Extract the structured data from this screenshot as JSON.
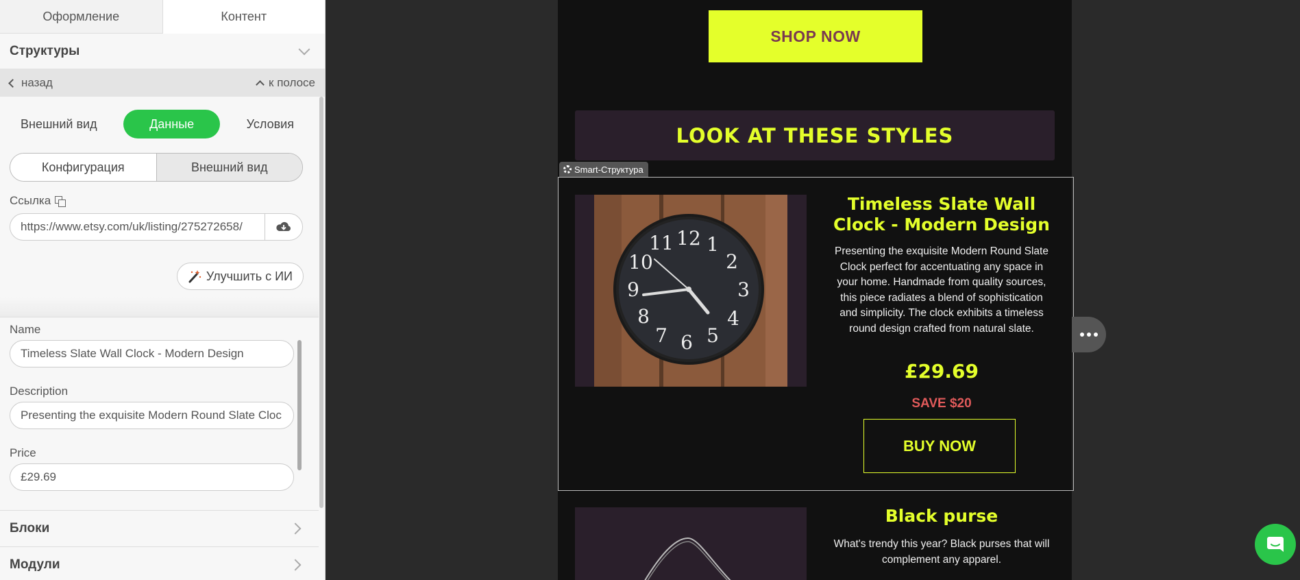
{
  "panel": {
    "top_tabs": [
      "Оформление",
      "Контент"
    ],
    "structures_title": "Структуры",
    "back_label": "назад",
    "to_stripe_label": "к полосе",
    "view_tabs": [
      "Внешний вид",
      "Данные",
      "Условия"
    ],
    "sub_tabs": [
      "Конфигурация",
      "Внешний вид"
    ],
    "link_label": "Ссылка",
    "link_value": "https://www.etsy.com/uk/listing/275272658/",
    "ai_button": "Улучшить с ИИ",
    "name_label": "Name",
    "name_value": "Timeless Slate Wall Clock - Modern Design",
    "description_label": "Description",
    "description_value": "Presenting the exquisite Modern Round Slate Cloc",
    "price_label": "Price",
    "price_value": "£29.69",
    "blocks_title": "Блоки",
    "modules_title": "Модули"
  },
  "email": {
    "shop_now": "SHOP NOW",
    "banner": "LOOK AT THESE STYLES",
    "smart_tag": "Smart-Структура",
    "product1": {
      "title": "Timeless Slate Wall Clock - Modern Design",
      "description": "Presenting the exquisite Modern Round Slate Clock perfect for accentuating any space in your home. Handmade from quality sources, this piece radiates a blend of sophistication and simplicity. The clock exhibits a timeless round design crafted from natural slate.",
      "price": "£29.69",
      "save": "SAVE $20",
      "buy": "BUY NOW"
    },
    "product2": {
      "title": "Black purse",
      "description": "What's trendy this year? Black purses that will complement any apparel."
    }
  },
  "colors": {
    "accent_green": "#2ac54a",
    "neon_yellow": "#e4ff2b",
    "save_red": "#e05a5a",
    "email_bg": "#111111",
    "card_bg": "#2a1f2b"
  }
}
